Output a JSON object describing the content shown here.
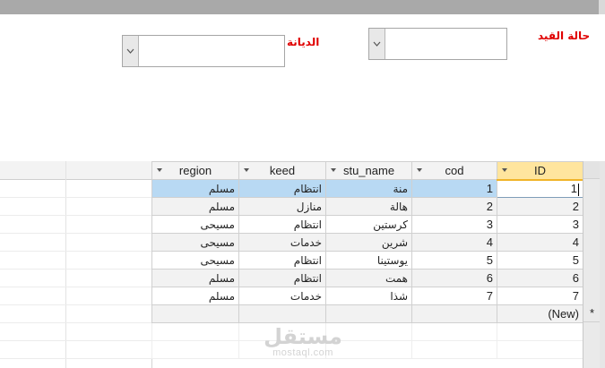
{
  "filters": {
    "status_label": "حالة القيد",
    "religion_label": "الديانة",
    "status_value": "",
    "religion_value": ""
  },
  "table": {
    "columns": [
      {
        "key": "region",
        "label": "region"
      },
      {
        "key": "keed",
        "label": "keed"
      },
      {
        "key": "stu_name",
        "label": "stu_name"
      },
      {
        "key": "cod",
        "label": "cod"
      },
      {
        "key": "id",
        "label": "ID"
      }
    ],
    "rows": [
      {
        "region": "مسلم",
        "keed": "انتظام",
        "stu_name": "منة",
        "cod": "1",
        "id": "1"
      },
      {
        "region": "مسلم",
        "keed": "منازل",
        "stu_name": "هالة",
        "cod": "2",
        "id": "2"
      },
      {
        "region": "مسيحى",
        "keed": "انتظام",
        "stu_name": "كرستين",
        "cod": "3",
        "id": "3"
      },
      {
        "region": "مسيحى",
        "keed": "خدمات",
        "stu_name": "شرين",
        "cod": "4",
        "id": "4"
      },
      {
        "region": "مسيحى",
        "keed": "انتظام",
        "stu_name": "يوستينا",
        "cod": "5",
        "id": "5"
      },
      {
        "region": "مسلم",
        "keed": "انتظام",
        "stu_name": "همت",
        "cod": "6",
        "id": "6"
      },
      {
        "region": "مسلم",
        "keed": "خدمات",
        "stu_name": "شذا",
        "cod": "7",
        "id": "7"
      }
    ],
    "new_row_label": "(New)",
    "new_row_marker": "*"
  },
  "watermark": {
    "arabic": "مستقل",
    "latin": "mostaql.com"
  },
  "colors": {
    "label_red": "#e00000",
    "selected_row": "#b8d9f3",
    "selected_header": "#ffe59e"
  }
}
